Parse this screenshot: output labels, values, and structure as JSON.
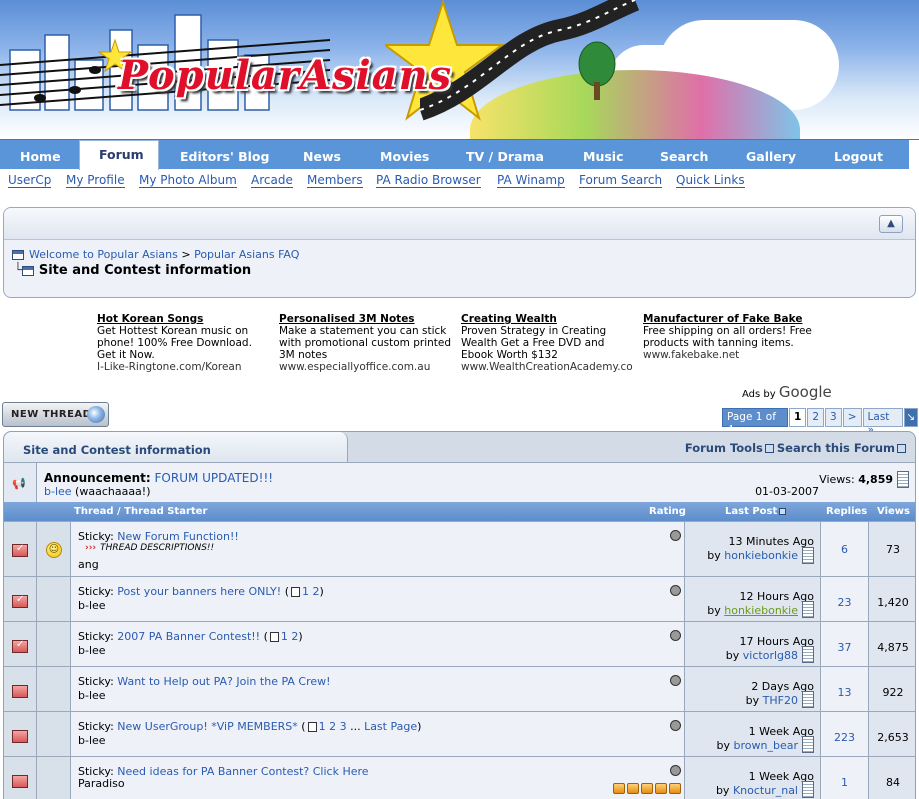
{
  "banner": {
    "logo_text": "PopularAsians"
  },
  "nav": {
    "items": [
      "Home",
      "Forum",
      "Editors' Blog",
      "News",
      "Movies",
      "TV / Drama",
      "Music",
      "Search",
      "Gallery",
      "Logout"
    ],
    "active": "Forum"
  },
  "subnav": {
    "items": [
      "UserCp",
      "My Profile",
      "My Photo Album",
      "Arcade",
      "Members",
      "PA Radio Browser",
      "PA Winamp",
      "Forum Search",
      "Quick Links"
    ]
  },
  "breadcrumb": {
    "links": [
      "Welcome to Popular Asians",
      "Popular Asians FAQ"
    ],
    "separator": ">",
    "current": "Site and Contest information"
  },
  "ads": [
    {
      "title": "Hot Korean Songs",
      "body": "Get Hottest Korean music on phone! 100% Free Download. Get it Now.",
      "url": "I-Like-Ringtone.com/Korean"
    },
    {
      "title": "Personalised 3M Notes",
      "body": "Make a statement you can stick with promotional custom printed 3M notes",
      "url": "www.especiallyoffice.com.au"
    },
    {
      "title": "Creating Wealth",
      "body": "Proven Strategy in Creating Wealth Get a Free DVD and Ebook Worth $132",
      "url": "www.WealthCreationAcademy.co"
    },
    {
      "title": "Manufacturer of Fake Bake",
      "body": "Free shipping on all orders! Free products with tanning items.",
      "url": "www.fakebake.net"
    }
  ],
  "ads_by": {
    "prefix": "Ads by",
    "brand": "Google"
  },
  "toolbar": {
    "new_thread_label": "NEW THREAD"
  },
  "pagination": {
    "label": "Page 1 of 4",
    "pages": [
      "1",
      "2",
      "3"
    ],
    "current": "1",
    "next": ">",
    "last": "Last »"
  },
  "forum": {
    "title": "Site and Contest information",
    "tools_label": "Forum Tools",
    "search_label": "Search this Forum"
  },
  "announcement": {
    "prefix": "Announcement:",
    "title": "FORUM UPDATED!!!",
    "poster": "b-lee",
    "poster_note": "(waachaaaa!)",
    "views_label": "Views:",
    "views": "4,859",
    "date": "01-03-2007"
  },
  "columns": {
    "thread": "Thread / Thread Starter",
    "rating": "Rating",
    "last_post": "Last Post",
    "replies": "Replies",
    "views": "Views"
  },
  "threads": [
    {
      "prefix": "Sticky:",
      "title": "New Forum Function!!",
      "desc_marker": "›››",
      "description": "THREAD DESCRIPTIONS!!",
      "starter": "ang",
      "pages": [],
      "last_page": "",
      "last_time": "13 Minutes Ago",
      "last_by": "honkiebonkie",
      "replies": "6",
      "views": "73",
      "rating": 0
    },
    {
      "prefix": "Sticky:",
      "title": "Post your banners here ONLY!",
      "description": "",
      "starter": "b-lee",
      "pages": [
        "1",
        "2"
      ],
      "last_page": "",
      "last_time": "12 Hours Ago",
      "last_by": "honkiebonkie",
      "replies": "23",
      "views": "1,420",
      "rating": 0
    },
    {
      "prefix": "Sticky:",
      "title": "2007 PA Banner Contest!!",
      "description": "",
      "starter": "b-lee",
      "pages": [
        "1",
        "2"
      ],
      "last_page": "",
      "last_time": "17 Hours Ago",
      "last_by": "victorlg88",
      "replies": "37",
      "views": "4,875",
      "rating": 0
    },
    {
      "prefix": "Sticky:",
      "title": "Want to Help out PA? Join the PA Crew!",
      "description": "",
      "starter": "b-lee",
      "pages": [],
      "last_page": "",
      "last_time": "2 Days Ago",
      "last_by": "THF20",
      "replies": "13",
      "views": "922",
      "rating": 0
    },
    {
      "prefix": "Sticky:",
      "title": "New UserGroup! *ViP MEMBERS*",
      "description": "",
      "starter": "b-lee",
      "pages": [
        "1",
        "2",
        "3"
      ],
      "last_page": "Last Page",
      "last_time": "1 Week Ago",
      "last_by": "brown_bear",
      "replies": "223",
      "views": "2,653",
      "rating": 0
    },
    {
      "prefix": "Sticky:",
      "title": "Need ideas for PA Banner Contest? Click Here",
      "description": "",
      "starter": "Paradiso",
      "pages": [],
      "last_page": "",
      "last_time": "1 Week Ago",
      "last_by": "Knoctur_nal",
      "replies": "1",
      "views": "84",
      "rating": 5
    }
  ],
  "colors": {
    "nav_blue": "#5b95d9",
    "link_blue": "#2a5bb0",
    "header_blue": "#5d8dcb",
    "logo_red": "#e0102a"
  }
}
